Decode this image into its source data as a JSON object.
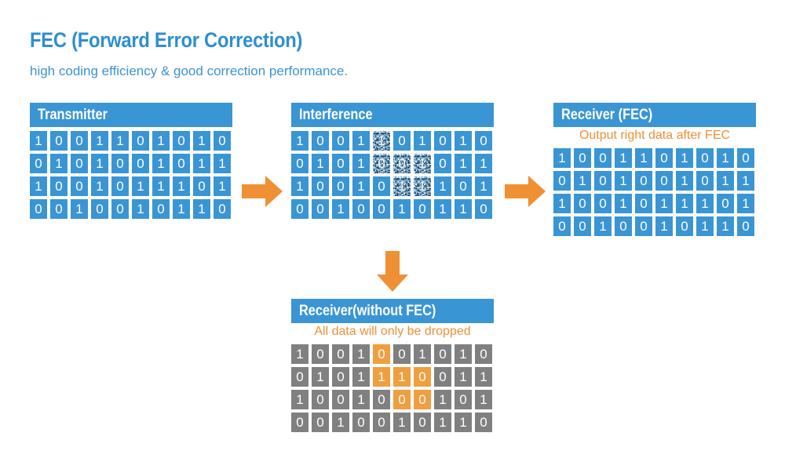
{
  "title": "FEC (Forward Error Correction)",
  "subtitle": "high coding efficiency & good correction performance.",
  "colors": {
    "blue": "#3a95d4",
    "title_blue": "#2e8fd0",
    "orange": "#ef9035",
    "orange_cell": "#ef9f3f",
    "gray_cell": "#808080",
    "white": "#ffffff"
  },
  "panels": {
    "transmitter": {
      "header": "Transmitter",
      "caption": "",
      "rows": [
        [
          "1",
          "0",
          "0",
          "1",
          "1",
          "0",
          "1",
          "0",
          "1",
          "0"
        ],
        [
          "0",
          "1",
          "0",
          "1",
          "0",
          "0",
          "1",
          "0",
          "1",
          "1"
        ],
        [
          "1",
          "0",
          "0",
          "1",
          "0",
          "1",
          "1",
          "1",
          "0",
          "1"
        ],
        [
          "0",
          "0",
          "1",
          "0",
          "0",
          "1",
          "0",
          "1",
          "1",
          "0"
        ]
      ],
      "states": [
        [
          "normal",
          "normal",
          "normal",
          "normal",
          "normal",
          "normal",
          "normal",
          "normal",
          "normal",
          "normal"
        ],
        [
          "normal",
          "normal",
          "normal",
          "normal",
          "normal",
          "normal",
          "normal",
          "normal",
          "normal",
          "normal"
        ],
        [
          "normal",
          "normal",
          "normal",
          "normal",
          "normal",
          "normal",
          "normal",
          "normal",
          "normal",
          "normal"
        ],
        [
          "normal",
          "normal",
          "normal",
          "normal",
          "normal",
          "normal",
          "normal",
          "normal",
          "normal",
          "normal"
        ]
      ]
    },
    "interference": {
      "header": "Interference",
      "caption": "",
      "rows": [
        [
          "1",
          "0",
          "0",
          "1",
          "1",
          "0",
          "1",
          "0",
          "1",
          "0"
        ],
        [
          "0",
          "1",
          "0",
          "1",
          "0",
          "0",
          "1",
          "0",
          "1",
          "1"
        ],
        [
          "1",
          "0",
          "0",
          "1",
          "0",
          "1",
          "1",
          "1",
          "0",
          "1"
        ],
        [
          "0",
          "0",
          "1",
          "0",
          "0",
          "1",
          "0",
          "1",
          "1",
          "0"
        ]
      ],
      "states": [
        [
          "normal",
          "normal",
          "normal",
          "normal",
          "noise",
          "normal",
          "normal",
          "normal",
          "normal",
          "normal"
        ],
        [
          "normal",
          "normal",
          "normal",
          "normal",
          "noise",
          "noise",
          "noise",
          "normal",
          "normal",
          "normal"
        ],
        [
          "normal",
          "normal",
          "normal",
          "normal",
          "normal",
          "noise",
          "noise",
          "normal",
          "normal",
          "normal"
        ],
        [
          "normal",
          "normal",
          "normal",
          "normal",
          "normal",
          "normal",
          "normal",
          "normal",
          "normal",
          "normal"
        ]
      ]
    },
    "receiver_fec": {
      "header": "Receiver (FEC)",
      "caption": "Output right data after FEC",
      "rows": [
        [
          "1",
          "0",
          "0",
          "1",
          "1",
          "0",
          "1",
          "0",
          "1",
          "0"
        ],
        [
          "0",
          "1",
          "0",
          "1",
          "0",
          "0",
          "1",
          "0",
          "1",
          "1"
        ],
        [
          "1",
          "0",
          "0",
          "1",
          "0",
          "1",
          "1",
          "1",
          "0",
          "1"
        ],
        [
          "0",
          "0",
          "1",
          "0",
          "0",
          "1",
          "0",
          "1",
          "1",
          "0"
        ]
      ],
      "states": [
        [
          "normal",
          "normal",
          "normal",
          "normal",
          "normal",
          "normal",
          "normal",
          "normal",
          "normal",
          "normal"
        ],
        [
          "normal",
          "normal",
          "normal",
          "normal",
          "normal",
          "normal",
          "normal",
          "normal",
          "normal",
          "normal"
        ],
        [
          "normal",
          "normal",
          "normal",
          "normal",
          "normal",
          "normal",
          "normal",
          "normal",
          "normal",
          "normal"
        ],
        [
          "normal",
          "normal",
          "normal",
          "normal",
          "normal",
          "normal",
          "normal",
          "normal",
          "normal",
          "normal"
        ]
      ]
    },
    "receiver_nofec": {
      "header": "Receiver(without FEC)",
      "caption": "All data will only be dropped",
      "rows": [
        [
          "1",
          "0",
          "0",
          "1",
          "0",
          "0",
          "1",
          "0",
          "1",
          "0"
        ],
        [
          "0",
          "1",
          "0",
          "1",
          "1",
          "1",
          "0",
          "0",
          "1",
          "1"
        ],
        [
          "1",
          "0",
          "0",
          "1",
          "0",
          "0",
          "0",
          "1",
          "0",
          "1"
        ],
        [
          "0",
          "0",
          "1",
          "0",
          "0",
          "1",
          "0",
          "1",
          "1",
          "0"
        ]
      ],
      "states": [
        [
          "gray",
          "gray",
          "gray",
          "gray",
          "orange",
          "gray",
          "gray",
          "gray",
          "gray",
          "gray"
        ],
        [
          "gray",
          "gray",
          "gray",
          "gray",
          "orange",
          "orange",
          "orange",
          "gray",
          "gray",
          "gray"
        ],
        [
          "gray",
          "gray",
          "gray",
          "gray",
          "gray",
          "orange",
          "orange",
          "gray",
          "gray",
          "gray"
        ],
        [
          "gray",
          "gray",
          "gray",
          "gray",
          "gray",
          "gray",
          "gray",
          "gray",
          "gray",
          "gray"
        ]
      ]
    }
  },
  "arrows": {
    "transmitter_to_interference": "arrow-right-icon",
    "interference_to_receiver_fec": "arrow-right-icon",
    "interference_to_receiver_nofec": "arrow-down-icon"
  }
}
